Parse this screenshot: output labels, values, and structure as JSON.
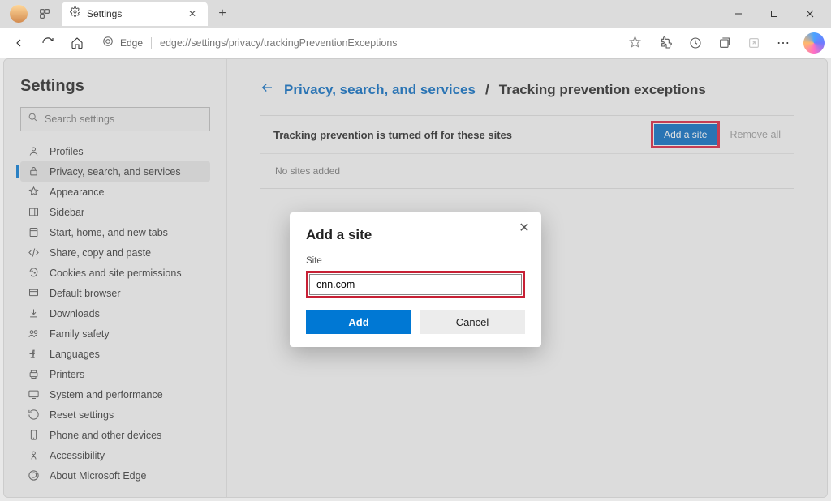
{
  "window": {
    "tab_title": "Settings",
    "address_label": "Edge",
    "url_display": "edge://settings/privacy/trackingPreventionExceptions"
  },
  "sidebar": {
    "heading": "Settings",
    "search_placeholder": "Search settings",
    "items": [
      {
        "label": "Profiles"
      },
      {
        "label": "Privacy, search, and services"
      },
      {
        "label": "Appearance"
      },
      {
        "label": "Sidebar"
      },
      {
        "label": "Start, home, and new tabs"
      },
      {
        "label": "Share, copy and paste"
      },
      {
        "label": "Cookies and site permissions"
      },
      {
        "label": "Default browser"
      },
      {
        "label": "Downloads"
      },
      {
        "label": "Family safety"
      },
      {
        "label": "Languages"
      },
      {
        "label": "Printers"
      },
      {
        "label": "System and performance"
      },
      {
        "label": "Reset settings"
      },
      {
        "label": "Phone and other devices"
      },
      {
        "label": "Accessibility"
      },
      {
        "label": "About Microsoft Edge"
      }
    ],
    "active_index": 1
  },
  "main": {
    "breadcrumb_link": "Privacy, search, and services",
    "breadcrumb_sep": "/",
    "breadcrumb_current": "Tracking prevention exceptions",
    "panel_heading": "Tracking prevention is turned off for these sites",
    "add_button": "Add a site",
    "remove_all": "Remove all",
    "empty_text": "No sites added"
  },
  "dialog": {
    "title": "Add a site",
    "field_label": "Site",
    "field_value": "cnn.com",
    "add": "Add",
    "cancel": "Cancel"
  }
}
